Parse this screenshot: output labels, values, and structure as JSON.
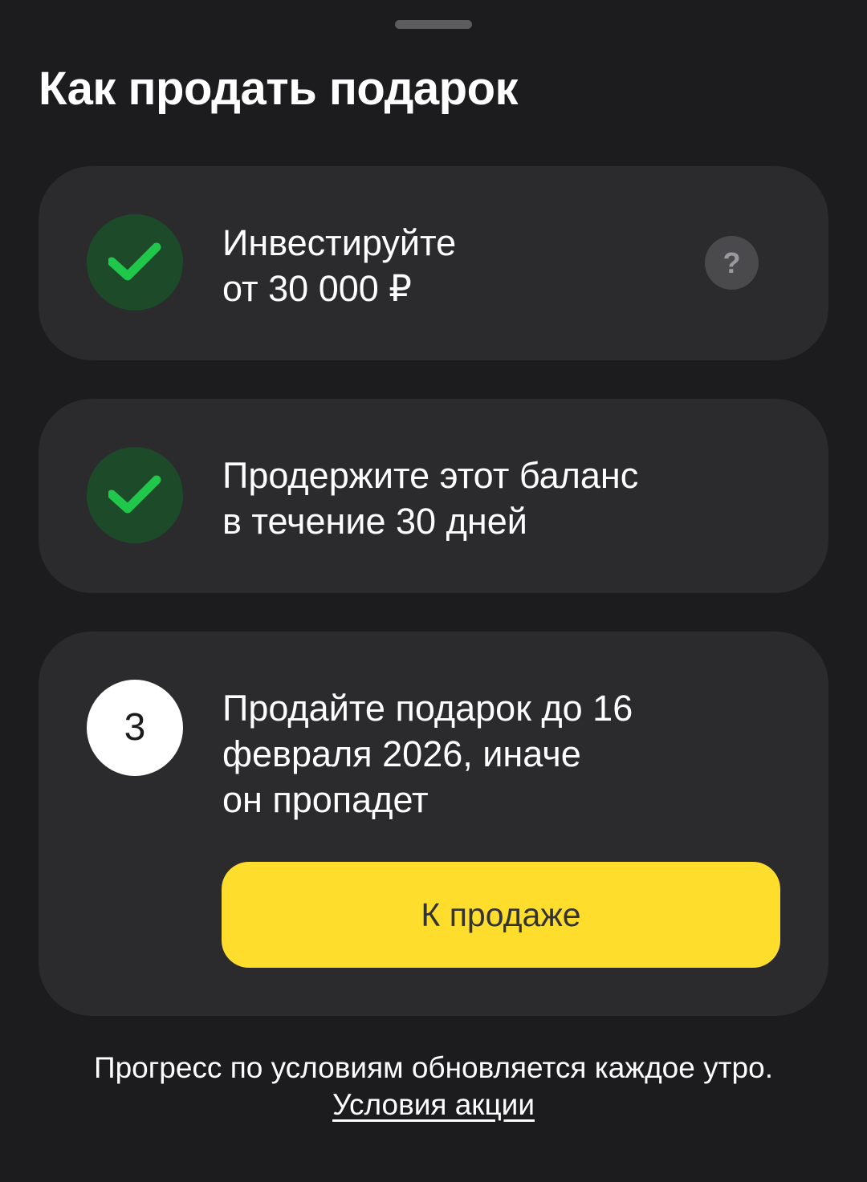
{
  "sheet": {
    "title": "Как продать подарок"
  },
  "steps": [
    {
      "state": "done",
      "icon": "check-icon",
      "text": "Инвестируйте\nот 30 000 ₽",
      "help_label": "?"
    },
    {
      "state": "done",
      "icon": "check-icon",
      "text": "Продержите этот баланс\nв течение 30 дней"
    },
    {
      "state": "current",
      "number": "3",
      "text": "Продайте подарок до 16\nфевраля 2026, иначе\nон пропадет",
      "button_label": "К продаже"
    }
  ],
  "footer": {
    "note": "Прогресс по условиям обновляется каждое утро.",
    "link_label": "Условия акции"
  },
  "colors": {
    "background": "#1c1c1e",
    "card": "#2b2b2d",
    "check_bg": "#1d4a29",
    "check": "#1fc74a",
    "accent": "#ffdd2d"
  }
}
